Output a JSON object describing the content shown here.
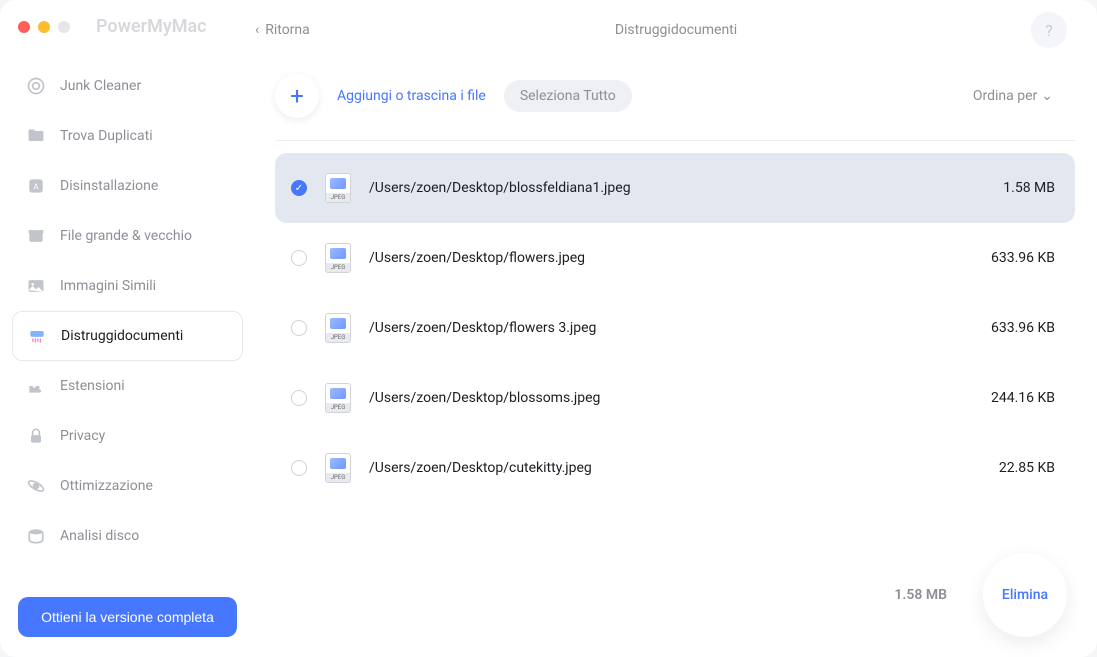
{
  "app_title": "PowerMyMac",
  "header": {
    "back_label": "Ritorna",
    "page_title": "Distruggidocumenti"
  },
  "sidebar": {
    "items": [
      {
        "label": "Junk Cleaner",
        "icon": "target-icon"
      },
      {
        "label": "Trova Duplicati",
        "icon": "folder-icon"
      },
      {
        "label": "Disinstallazione",
        "icon": "app-icon"
      },
      {
        "label": "File grande & vecchio",
        "icon": "box-icon"
      },
      {
        "label": "Immagini Simili",
        "icon": "image-icon"
      },
      {
        "label": "Distruggidocumenti",
        "icon": "shredder-icon"
      },
      {
        "label": "Estensioni",
        "icon": "puzzle-icon"
      },
      {
        "label": "Privacy",
        "icon": "lock-icon"
      },
      {
        "label": "Ottimizzazione",
        "icon": "orbit-icon"
      },
      {
        "label": "Analisi disco",
        "icon": "disk-icon"
      }
    ],
    "active_index": 5,
    "full_version_label": "Ottieni la versione completa"
  },
  "toolbar": {
    "add_label": "Aggiungi o trascina i file",
    "select_all_label": "Seleziona Tutto",
    "sort_label": "Ordina per"
  },
  "files": [
    {
      "path": "/Users/zoen/Desktop/blossfeldiana1.jpeg",
      "size": "1.58 MB",
      "checked": true,
      "type": "JPEG"
    },
    {
      "path": "/Users/zoen/Desktop/flowers.jpeg",
      "size": "633.96 KB",
      "checked": false,
      "type": "JPEG"
    },
    {
      "path": "/Users/zoen/Desktop/flowers 3.jpeg",
      "size": "633.96 KB",
      "checked": false,
      "type": "JPEG"
    },
    {
      "path": "/Users/zoen/Desktop/blossoms.jpeg",
      "size": "244.16 KB",
      "checked": false,
      "type": "JPEG"
    },
    {
      "path": "/Users/zoen/Desktop/cutekitty.jpeg",
      "size": "22.85 KB",
      "checked": false,
      "type": "JPEG"
    }
  ],
  "footer": {
    "total_size": "1.58 MB",
    "delete_label": "Elimina"
  }
}
